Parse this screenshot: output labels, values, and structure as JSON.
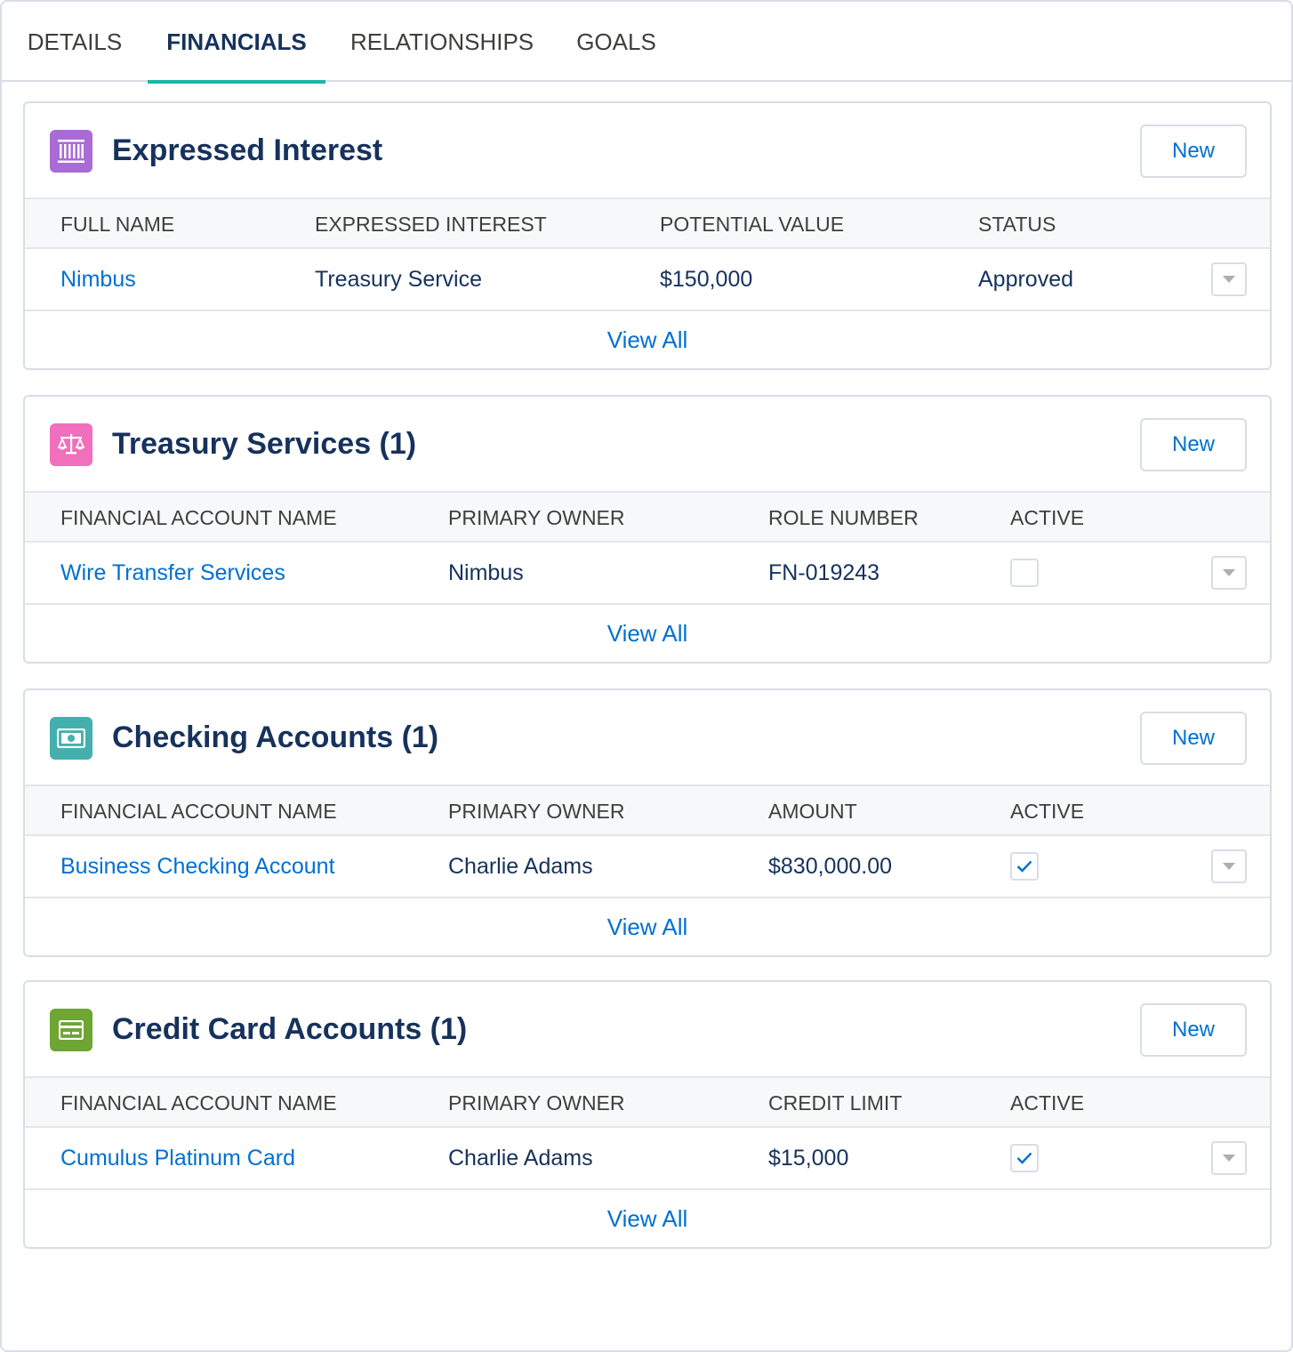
{
  "tabs": [
    {
      "label": "DETAILS",
      "active": false
    },
    {
      "label": "FINANCIALS",
      "active": true
    },
    {
      "label": "RELATIONSHIPS",
      "active": false
    },
    {
      "label": "GOALS",
      "active": false
    }
  ],
  "colors": {
    "accent_tab": "#1bb6a6",
    "link": "#0070d2",
    "title": "#16325c",
    "icon_expressed_interest": "#a96bd6",
    "icon_treasury": "#f16fbd",
    "icon_checking": "#44b0ad",
    "icon_credit": "#6ea533"
  },
  "expressed_interest": {
    "title": "Expressed Interest",
    "icon": "list-barcode-icon",
    "new_label": "New",
    "columns": [
      "FULL NAME",
      "EXPRESSED INTEREST",
      "POTENTIAL VALUE",
      "STATUS"
    ],
    "row": {
      "full_name": "Nimbus",
      "expressed_interest": "Treasury Service",
      "potential_value": "$150,000",
      "status": "Approved"
    },
    "view_all": "View All"
  },
  "treasury_services": {
    "title": "Treasury Services (1)",
    "icon": "scales-icon",
    "new_label": "New",
    "columns": [
      "FINANCIAL ACCOUNT NAME",
      "PRIMARY OWNER",
      "ROLE NUMBER",
      "ACTIVE"
    ],
    "row": {
      "name": "Wire Transfer Services",
      "owner": "Nimbus",
      "value": "FN-019243",
      "active": false
    },
    "view_all": "View All"
  },
  "checking_accounts": {
    "title": "Checking Accounts (1)",
    "icon": "cash-icon",
    "new_label": "New",
    "columns": [
      "FINANCIAL ACCOUNT NAME",
      "PRIMARY OWNER",
      "AMOUNT",
      "ACTIVE"
    ],
    "row": {
      "name": "Business Checking Account",
      "owner": "Charlie Adams",
      "value": "$830,000.00",
      "active": true
    },
    "view_all": "View All"
  },
  "credit_card_accounts": {
    "title": "Credit Card Accounts (1)",
    "icon": "credit-card-icon",
    "new_label": "New",
    "columns": [
      "FINANCIAL ACCOUNT NAME",
      "PRIMARY OWNER",
      "CREDIT LIMIT",
      "ACTIVE"
    ],
    "row": {
      "name": "Cumulus Platinum Card",
      "owner": "Charlie Adams",
      "value": "$15,000",
      "active": true
    },
    "view_all": "View All"
  }
}
